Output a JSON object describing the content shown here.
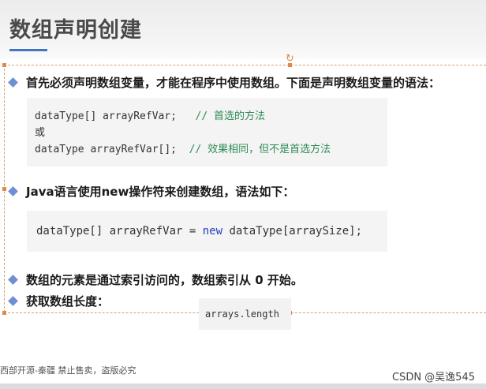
{
  "header": {
    "title": "数组声明创建"
  },
  "bullets": [
    {
      "text": "首先必须声明数组变量，才能在程序中使用数组。下面是声明数组变量的语法："
    },
    {
      "text": "Java语言使用new操作符来创建数组，语法如下："
    },
    {
      "text": "数组的元素是通过索引访问的，数组索引从 0 开始。"
    },
    {
      "text": "获取数组长度："
    }
  ],
  "code_block_1": {
    "line1_code": "dataType[] arrayRefVar;   ",
    "line1_comment": "// 首选的方法",
    "line2": "或",
    "line3_code": "dataType arrayRefVar[];  ",
    "line3_comment": "// 效果相同，但不是首选方法"
  },
  "code_block_2": {
    "before_kw": "dataType[] arrayRefVar = ",
    "keyword": "new",
    "after_kw": " dataType[arraySize];"
  },
  "code_block_3": {
    "text": "arrays.length"
  },
  "footer": {
    "left_text": "西部开源-秦疆    禁止售卖，盗版必究",
    "watermark": "CSDN @吴逸545"
  },
  "colors": {
    "accent_bullet": "#6f8fd2",
    "title_underline": "#4472c4",
    "comment_green": "#2e8b57",
    "keyword_blue": "#1f3fbf"
  }
}
